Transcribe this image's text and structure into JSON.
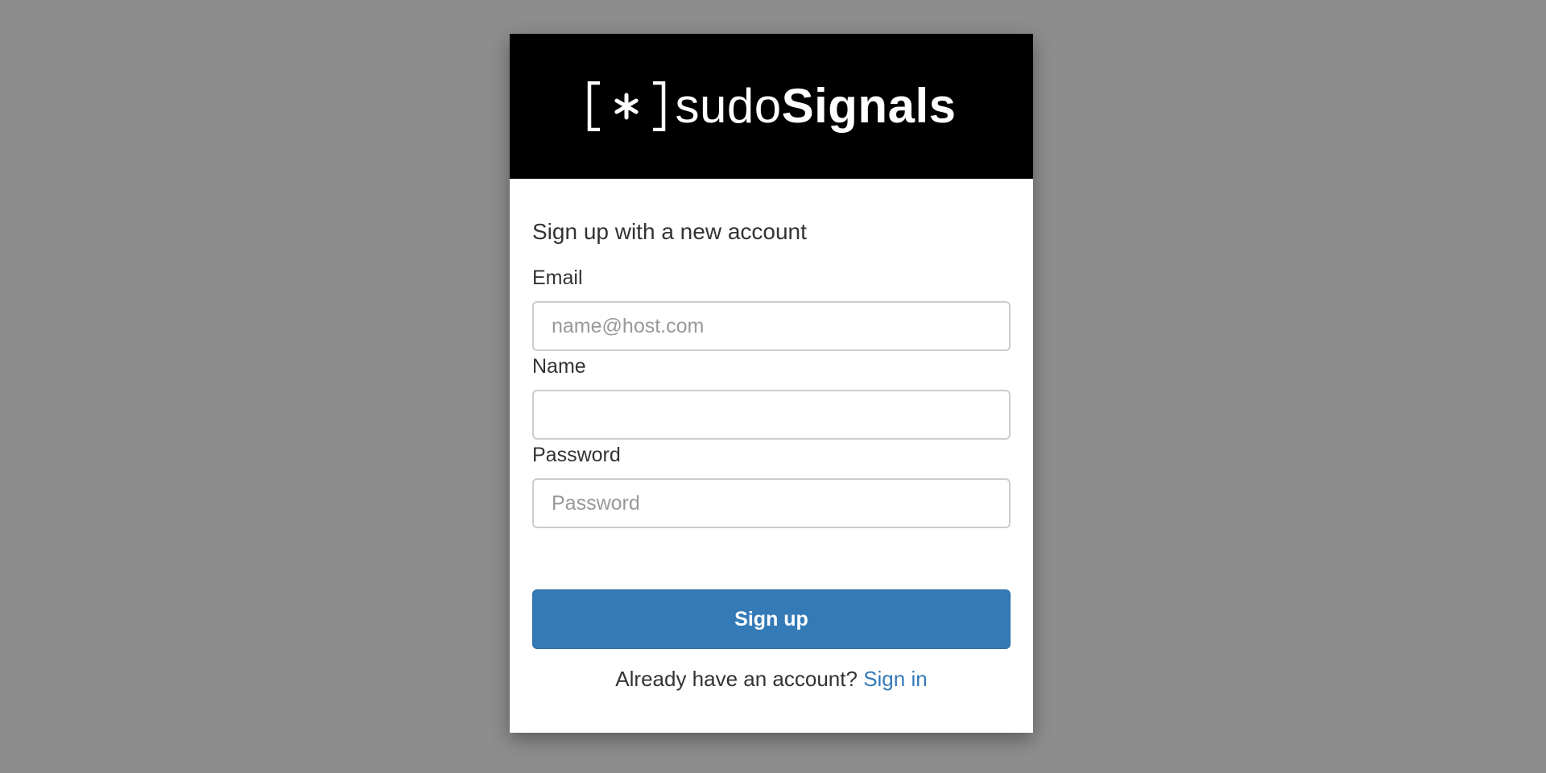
{
  "logo": {
    "mark": "[*]",
    "thin": "sudo",
    "bold": "Signals"
  },
  "form": {
    "heading": "Sign up with a new account",
    "email": {
      "label": "Email",
      "placeholder": "name@host.com",
      "value": ""
    },
    "name": {
      "label": "Name",
      "placeholder": "",
      "value": ""
    },
    "password": {
      "label": "Password",
      "placeholder": "Password",
      "value": ""
    },
    "submit_label": "Sign up",
    "signin_prompt": "Already have an account?",
    "signin_link": "Sign in"
  },
  "colors": {
    "backdrop": "#8d8d8d",
    "banner": "#000000",
    "primary": "#337ab7",
    "text": "#333333"
  },
  "icons": {
    "logo_mark": "bracketed-asterisk-icon"
  }
}
